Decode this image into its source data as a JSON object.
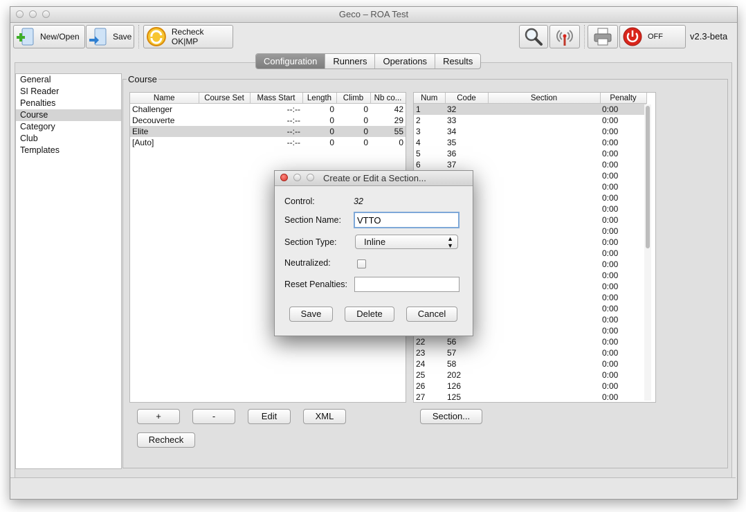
{
  "window": {
    "title": "Geco – ROA Test"
  },
  "toolbar": {
    "new_open": "New/Open",
    "save": "Save",
    "recheck": "Recheck OK|MP",
    "off": "OFF",
    "version": "v2.3-beta"
  },
  "tabs": [
    "Configuration",
    "Runners",
    "Operations",
    "Results"
  ],
  "active_tab": "Configuration",
  "sidebar": [
    "General",
    "SI Reader",
    "Penalties",
    "Course",
    "Category",
    "Club",
    "Templates"
  ],
  "selected_sidebar": "Course",
  "course_panel": {
    "label": "Course",
    "columns": [
      "Name",
      "Course Set",
      "Mass Start",
      "Length",
      "Climb",
      "Nb co..."
    ],
    "rows": [
      {
        "name": "Challenger",
        "course_set": "",
        "mass_start": "--:--",
        "length": "0",
        "climb": "0",
        "nb": "42"
      },
      {
        "name": "Decouverte",
        "course_set": "",
        "mass_start": "--:--",
        "length": "0",
        "climb": "0",
        "nb": "29"
      },
      {
        "name": "Elite",
        "course_set": "",
        "mass_start": "--:--",
        "length": "0",
        "climb": "0",
        "nb": "55"
      },
      {
        "name": "[Auto]",
        "course_set": "",
        "mass_start": "--:--",
        "length": "0",
        "climb": "0",
        "nb": "0"
      }
    ],
    "selected_row": 2,
    "buttons": {
      "add": "+",
      "remove": "-",
      "edit": "Edit",
      "xml": "XML",
      "recheck": "Recheck",
      "section": "Section..."
    }
  },
  "controls_table": {
    "columns": [
      "Num",
      "Code",
      "Section",
      "Penalty"
    ],
    "rows": [
      {
        "num": "1",
        "code": "32",
        "section": "",
        "penalty": "0:00"
      },
      {
        "num": "2",
        "code": "33",
        "section": "",
        "penalty": "0:00"
      },
      {
        "num": "3",
        "code": "34",
        "section": "",
        "penalty": "0:00"
      },
      {
        "num": "4",
        "code": "35",
        "section": "",
        "penalty": "0:00"
      },
      {
        "num": "5",
        "code": "36",
        "section": "",
        "penalty": "0:00"
      },
      {
        "num": "6",
        "code": "37",
        "section": "",
        "penalty": "0:00"
      },
      {
        "num": "",
        "code": "",
        "section": "",
        "penalty": "0:00"
      },
      {
        "num": "",
        "code": "",
        "section": "",
        "penalty": "0:00"
      },
      {
        "num": "",
        "code": "",
        "section": "",
        "penalty": "0:00"
      },
      {
        "num": "",
        "code": "",
        "section": "",
        "penalty": "0:00"
      },
      {
        "num": "",
        "code": "",
        "section": "",
        "penalty": "0:00"
      },
      {
        "num": "",
        "code": "",
        "section": "",
        "penalty": "0:00"
      },
      {
        "num": "",
        "code": "",
        "section": "",
        "penalty": "0:00"
      },
      {
        "num": "",
        "code": "",
        "section": "",
        "penalty": "0:00"
      },
      {
        "num": "",
        "code": "",
        "section": "",
        "penalty": "0:00"
      },
      {
        "num": "",
        "code": "",
        "section": "",
        "penalty": "0:00"
      },
      {
        "num": "",
        "code": "",
        "section": "",
        "penalty": "0:00"
      },
      {
        "num": "",
        "code": "",
        "section": "",
        "penalty": "0:00"
      },
      {
        "num": "",
        "code": "",
        "section": "",
        "penalty": "0:00"
      },
      {
        "num": "",
        "code": "",
        "section": "",
        "penalty": "0:00"
      },
      {
        "num": "",
        "code": "",
        "section": "",
        "penalty": "0:00"
      },
      {
        "num": "22",
        "code": "56",
        "section": "",
        "penalty": "0:00"
      },
      {
        "num": "23",
        "code": "57",
        "section": "",
        "penalty": "0:00"
      },
      {
        "num": "24",
        "code": "58",
        "section": "",
        "penalty": "0:00"
      },
      {
        "num": "25",
        "code": "202",
        "section": "",
        "penalty": "0:00"
      },
      {
        "num": "26",
        "code": "126",
        "section": "",
        "penalty": "0:00"
      },
      {
        "num": "27",
        "code": "125",
        "section": "",
        "penalty": "0:00"
      }
    ],
    "selected_row": 0
  },
  "dialog": {
    "title": "Create or Edit a Section...",
    "control_label": "Control:",
    "control_value": "32",
    "section_name_label": "Section Name:",
    "section_name_value": "VTTO",
    "section_type_label": "Section Type:",
    "section_type_value": "Inline",
    "neutralized_label": "Neutralized:",
    "reset_penalties_label": "Reset Penalties:",
    "reset_penalties_value": "",
    "save": "Save",
    "delete": "Delete",
    "cancel": "Cancel"
  },
  "colors": {
    "selection": "#d6d6d6",
    "active_tab": "#8a8a8a",
    "power_red": "#d9261c",
    "recheck_orange": "#f39c12",
    "new_green": "#3fae2a"
  }
}
